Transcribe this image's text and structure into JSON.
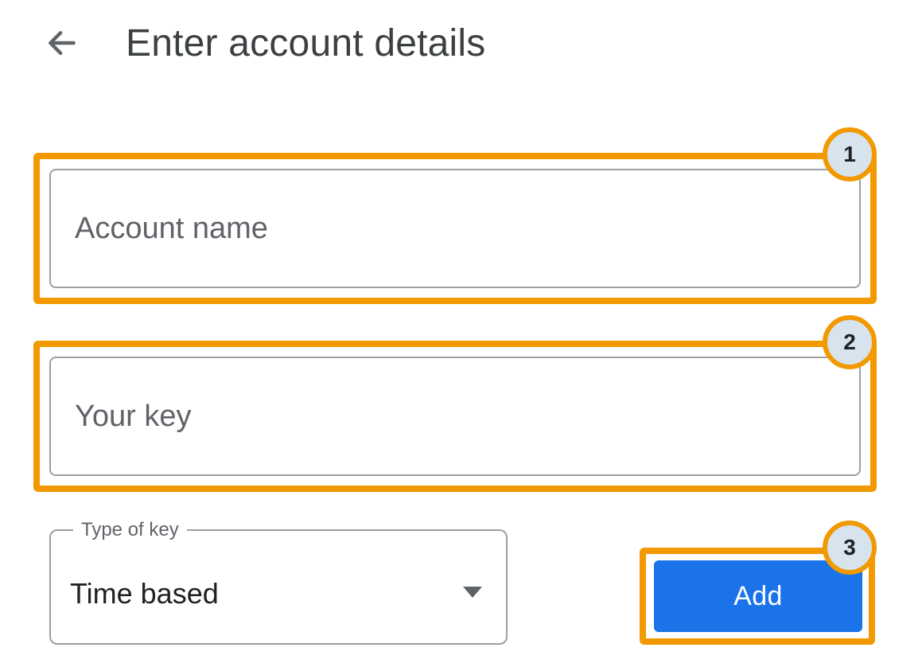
{
  "header": {
    "title": "Enter account details"
  },
  "fields": {
    "account_name": {
      "placeholder": "Account name",
      "value": ""
    },
    "your_key": {
      "placeholder": "Your key",
      "value": ""
    }
  },
  "select": {
    "label": "Type of key",
    "value": "Time based"
  },
  "actions": {
    "add_label": "Add"
  },
  "annotations": {
    "step1": "1",
    "step2": "2",
    "step3": "3",
    "highlight_color": "#f29900",
    "badge_fill": "#d7e3ed"
  }
}
